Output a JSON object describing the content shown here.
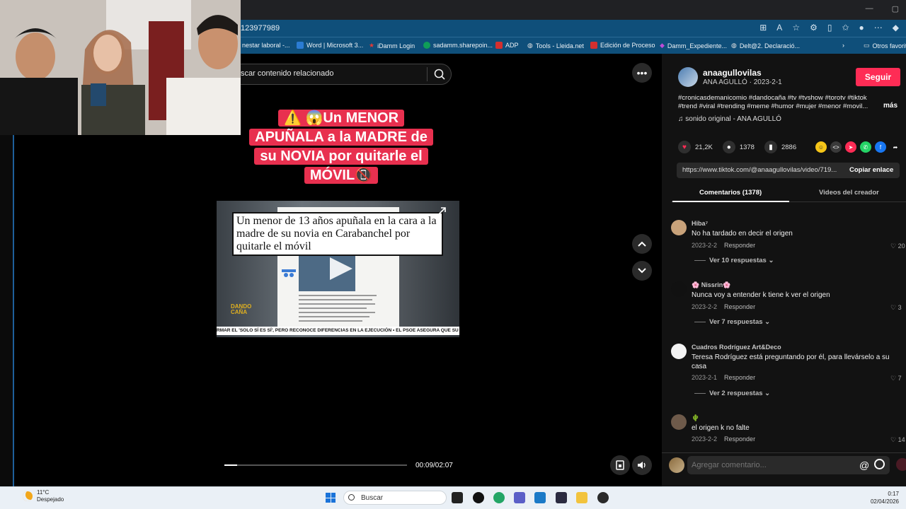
{
  "browser": {
    "address_text": "123977989",
    "bookmarks": [
      {
        "label": "nestar laboral -...",
        "icon": "bookmark-icon",
        "color": "#f1f1f1"
      },
      {
        "label": "Word | Microsoft 3...",
        "icon": "word-icon",
        "color": "#2b7cd3"
      },
      {
        "label": "iDamm Login",
        "icon": "star-icon",
        "color": "#e53935"
      },
      {
        "label": "sadamm.sharepoin...",
        "icon": "sharepoint-icon",
        "color": "#0f9d58"
      },
      {
        "label": "ADP",
        "icon": "adp-icon",
        "color": "#d32f2f"
      },
      {
        "label": "Tools - Lleida.net",
        "icon": "globe-icon",
        "color": "#e0e0e0"
      },
      {
        "label": "Edición de Proceso",
        "icon": "adp-icon",
        "color": "#d32f2f"
      },
      {
        "label": "Damm_Expediente...",
        "icon": "diamond-icon",
        "color": "#c04bd8"
      },
      {
        "label": "Delt@2. Declaració...",
        "icon": "globe-icon",
        "color": "#e0e0e0"
      },
      {
        "label": "Otros favorit",
        "icon": "folder-icon",
        "color": "#e0e0e0"
      }
    ]
  },
  "search": {
    "placeholder": "scar contenido relacionado"
  },
  "video": {
    "caption_lines": [
      "⚠️ 😱Un MENOR",
      "APUÑALA a la MADRE de",
      "su NOVIA por quitarle el",
      "MÓVIL📵"
    ],
    "headline": "Un menor de 13 años apuñala en la cara a la madre de su novia en Carabanchel por quitarle el móvil",
    "ticker": "RMAR EL 'SOLO SÍ ES SÍ', PERO RECONOCE DIFERENCIAS EN LA EJECUCIÓN  •  EL PSOE ASEGURA QUE SU REFORMA D",
    "logo_text": "DANDO CAÑA",
    "progress_fraction": 0.07,
    "time": "00:09/02:07"
  },
  "creator": {
    "username": "anaagullovilas",
    "subtitle": "ANA AGULLÓ · 2023-2-1",
    "follow_label": "Seguir",
    "description": "#cronicasdemanicomio #dandocaña #tv #tvshow #torotv #tiktok #trend #viral #trending #meme #humor #mujer #menor #movil...",
    "more_label": "más",
    "music": "sonido original - ANA AGULLÓ"
  },
  "stats": {
    "likes": "21,2K",
    "comments": "1378",
    "saves": "2886"
  },
  "share": {
    "link": "https://www.tiktok.com/@anaagullovilas/video/719...",
    "copy_label": "Copiar enlace"
  },
  "tabs": {
    "comments": "Comentarios (1378)",
    "creator_videos": "Videos del creador"
  },
  "comments": [
    {
      "name": "Hiba⁷",
      "text": "No ha tardado en decir el origen",
      "date": "2023-2-2",
      "reply": "Responder",
      "likes": "20",
      "replies": "Ver 10 respuestas",
      "avatar_color": "#c8a27a"
    },
    {
      "name": "🌸 Nissrin🌸",
      "text": "Nunca voy a entender k tiene k ver el origen",
      "date": "2023-2-2",
      "reply": "Responder",
      "likes": "3",
      "replies": "Ver 7 respuestas",
      "avatar_color": "#111111"
    },
    {
      "name": "Cuadros Rodríguez Art&Deco",
      "text": "Teresa Rodríguez está preguntando por él, para llevárselo a su casa",
      "date": "2023-2-1",
      "reply": "Responder",
      "likes": "7",
      "replies": "Ver 2 respuestas",
      "avatar_color": "#f3f3f3"
    },
    {
      "name": "🌵",
      "text": "el origen k no falte",
      "date": "2023-2-2",
      "reply": "Responder",
      "likes": "14",
      "replies": "",
      "avatar_color": "#6e5a4a"
    }
  ],
  "add_comment": {
    "placeholder": "Agregar comentario..."
  },
  "taskbar": {
    "temp": "11°C",
    "weather": "Despejado",
    "search_label": "Buscar",
    "time": "0:17",
    "date": "02/04/2026"
  }
}
